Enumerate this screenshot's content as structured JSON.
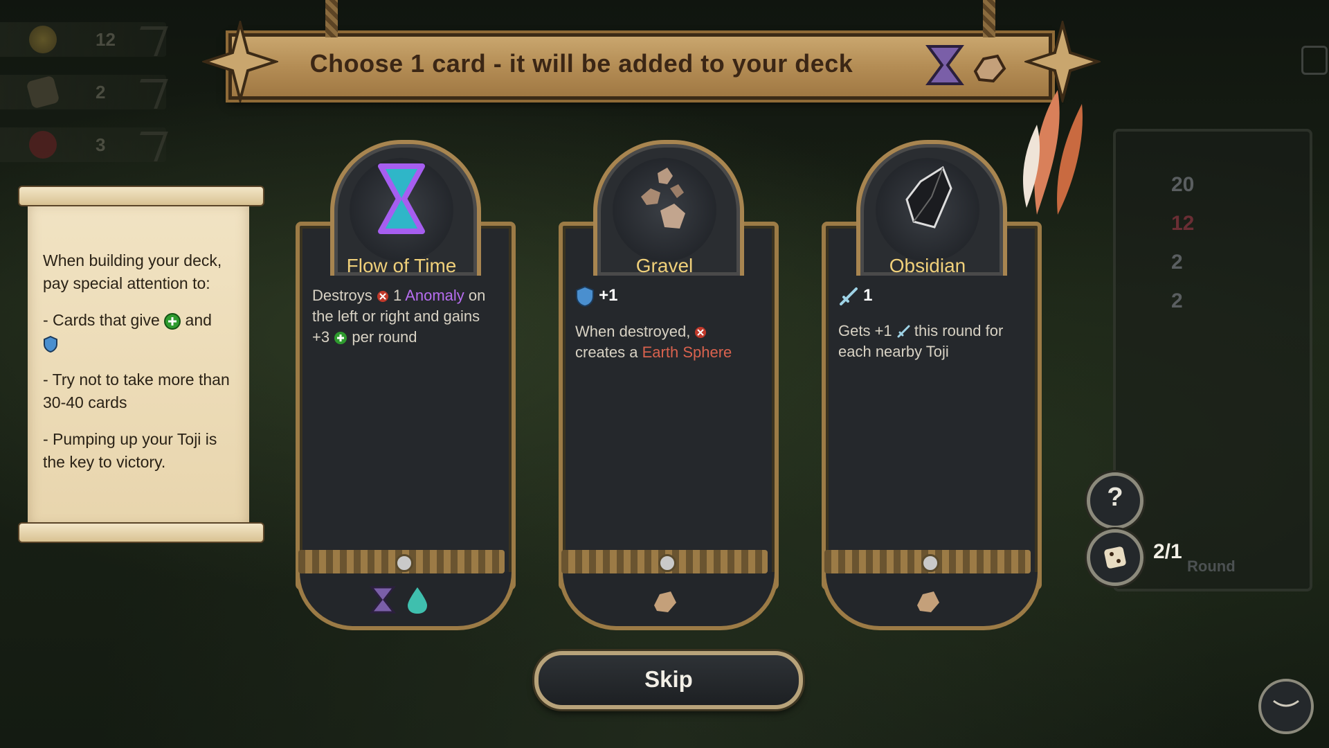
{
  "hud": {
    "resources": [
      {
        "icon": "coin-icon",
        "value": "12"
      },
      {
        "icon": "dice-icon",
        "value": "2"
      },
      {
        "icon": "red-x-icon",
        "value": "3"
      }
    ]
  },
  "banner": {
    "title": "Choose 1 card - it will be added to your deck"
  },
  "tip": {
    "lines": [
      "When building your deck, pay special attention to:",
      "- Cards that give",
      "and",
      "- Try not to take more than 30-40 cards",
      "- Pumping up your Toji is the key to victory."
    ]
  },
  "cards": [
    {
      "title": "Flow of Time",
      "desc": {
        "a": "Destroys",
        "b": "1",
        "c": "Anomaly",
        "d": "on the left or right and gains +3",
        "e": "per round"
      },
      "tags": [
        "hourglass-tag-icon",
        "water-drop-tag-icon"
      ]
    },
    {
      "title": "Gravel",
      "stat": "+1",
      "desc": {
        "a": "When destroyed,",
        "b": "creates a",
        "c": "Earth Sphere"
      },
      "tags": [
        "rock-tag-icon"
      ]
    },
    {
      "title": "Obsidian",
      "stat": "1",
      "desc": {
        "a": "Gets +1",
        "b": "this round for each nearby Toji"
      },
      "tags": [
        "rock-tag-icon"
      ]
    }
  ],
  "skip": {
    "label": "Skip"
  },
  "side": {
    "stats": [
      "20",
      "12",
      "2",
      "2"
    ],
    "help": "?",
    "round_count": "2/1",
    "round_label": "Round"
  },
  "colors": {
    "accent_gold": "#f0d07a",
    "anomaly_purple": "#b76df0",
    "earth_red": "#d9624e"
  }
}
